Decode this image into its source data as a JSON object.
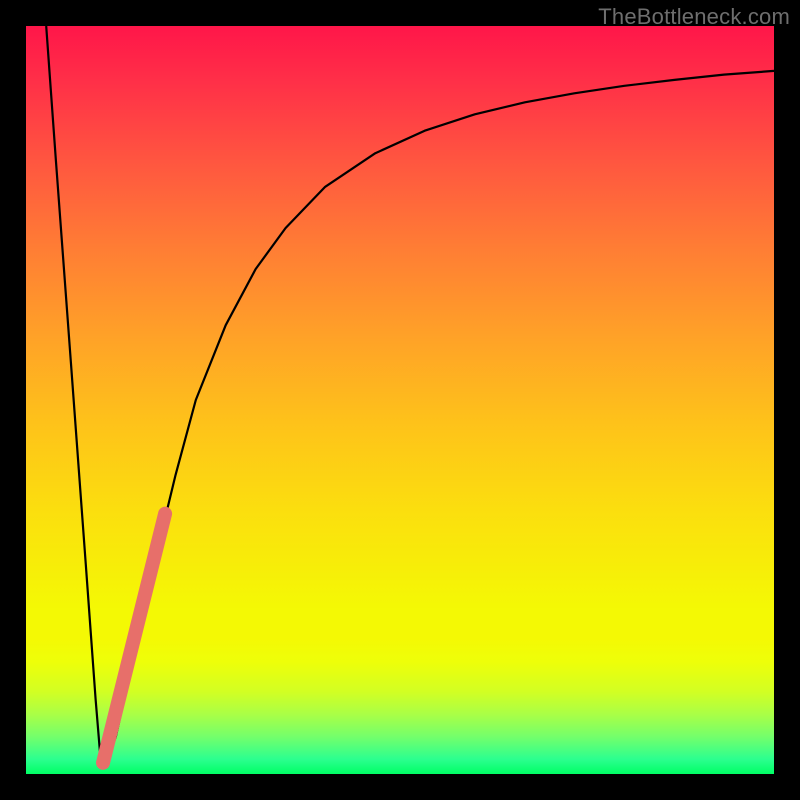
{
  "watermark": {
    "text": "TheBottleneck.com"
  },
  "plot": {
    "inner_x": 26,
    "inner_y": 26,
    "inner_w": 748,
    "inner_h": 748
  },
  "chart_data": {
    "type": "line",
    "title": "",
    "xlabel": "",
    "ylabel": "",
    "xlim": [
      0,
      100
    ],
    "ylim": [
      0,
      100
    ],
    "grid": false,
    "series": [
      {
        "name": "bottleneck-percent-curve",
        "color": "#000000",
        "stroke_width": 2.2,
        "x": [
          2.7,
          4.0,
          6.0,
          8.0,
          9.3,
          10.0,
          10.7,
          12.0,
          14.7,
          17.0,
          18.3,
          20.0,
          22.7,
          26.7,
          30.7,
          34.7,
          40.0,
          46.7,
          53.3,
          60.0,
          66.7,
          73.3,
          80.0,
          86.7,
          93.3,
          100.0
        ],
        "values": [
          100.0,
          82.0,
          55.0,
          28.0,
          10.0,
          1.6,
          1.4,
          5.0,
          17.0,
          27.0,
          33.0,
          40.0,
          50.0,
          60.0,
          67.5,
          73.0,
          78.5,
          83.0,
          86.0,
          88.2,
          89.8,
          91.0,
          92.0,
          92.8,
          93.5,
          94.0
        ]
      },
      {
        "name": "highlight-range-marker",
        "color": "#e76f6a",
        "stroke_width": 14,
        "linecap": "round",
        "x": [
          10.3,
          18.6
        ],
        "values": [
          1.5,
          34.8
        ]
      }
    ],
    "gradient_stops": [
      {
        "pos": 0.0,
        "color": "#ff1649"
      },
      {
        "pos": 0.07,
        "color": "#ff2e48"
      },
      {
        "pos": 0.19,
        "color": "#ff593f"
      },
      {
        "pos": 0.3,
        "color": "#ff7e34"
      },
      {
        "pos": 0.42,
        "color": "#ffa327"
      },
      {
        "pos": 0.53,
        "color": "#fec21a"
      },
      {
        "pos": 0.65,
        "color": "#fbdf0e"
      },
      {
        "pos": 0.78,
        "color": "#f4f904"
      },
      {
        "pos": 0.82,
        "color": "#f4f904"
      },
      {
        "pos": 0.85,
        "color": "#eeff09"
      },
      {
        "pos": 0.89,
        "color": "#d2ff23"
      },
      {
        "pos": 0.92,
        "color": "#aaff46"
      },
      {
        "pos": 0.95,
        "color": "#74ff6b"
      },
      {
        "pos": 0.98,
        "color": "#2cff8f"
      },
      {
        "pos": 1.0,
        "color": "#00ff65"
      }
    ]
  }
}
